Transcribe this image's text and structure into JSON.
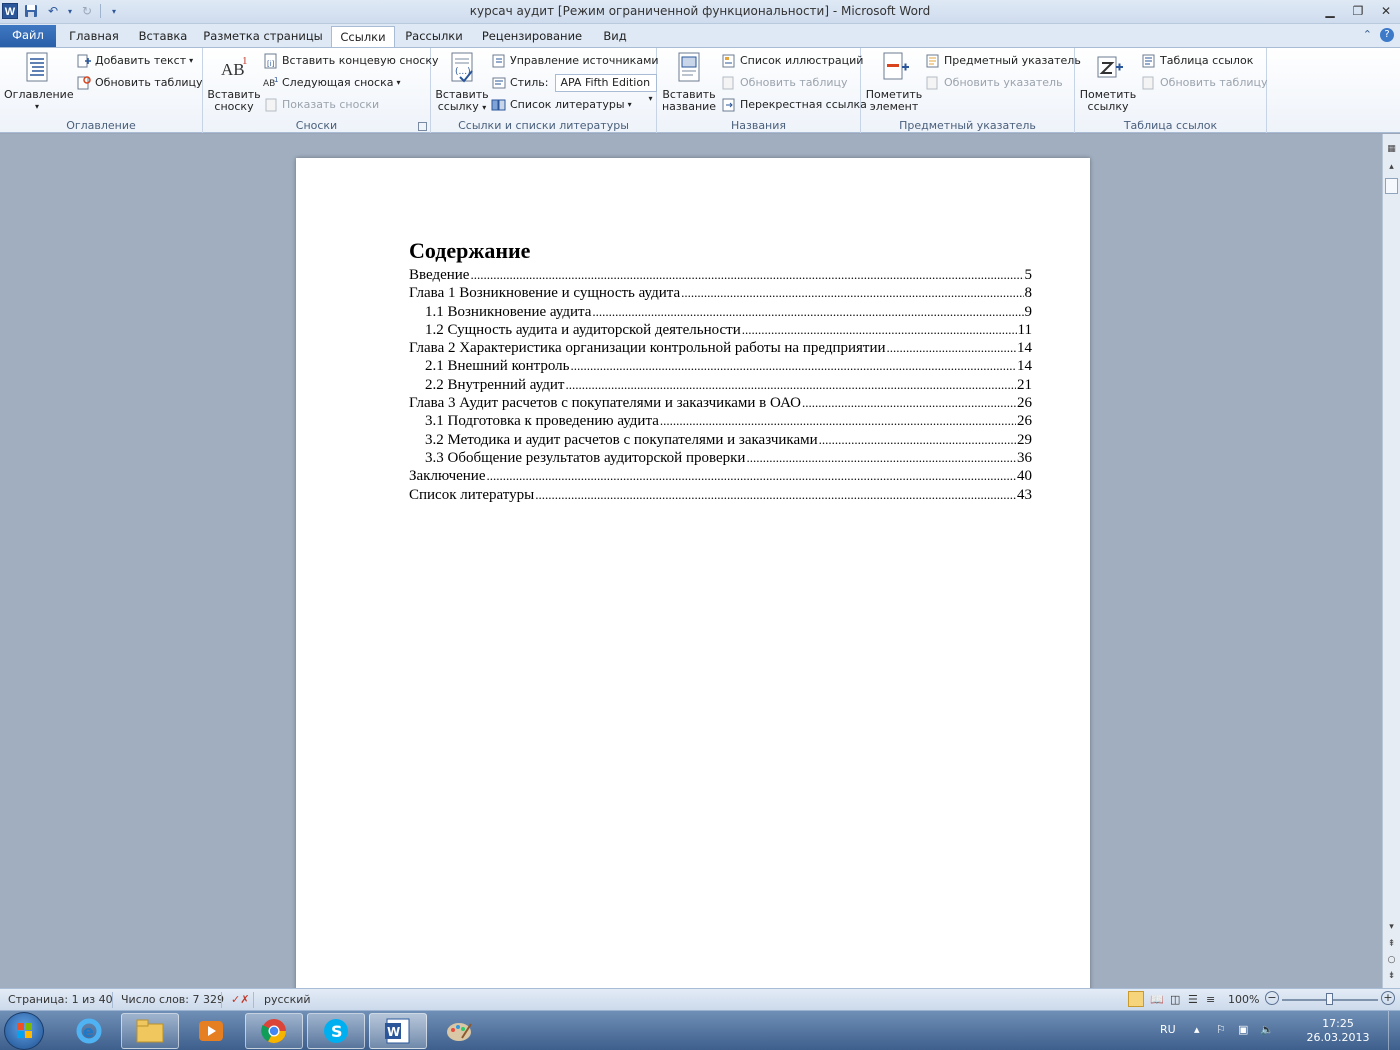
{
  "app": {
    "title": "курсач аудит [Режим ограниченной функциональности]  -  Microsoft Word",
    "logo": "W"
  },
  "tabs": {
    "file": "Файл",
    "items": [
      "Главная",
      "Вставка",
      "Разметка страницы",
      "Ссылки",
      "Рассылки",
      "Рецензирование",
      "Вид"
    ],
    "active": "Ссылки"
  },
  "ribbon": {
    "toc": {
      "label": "Оглавление",
      "big": "Оглавление",
      "add_text": "Добавить текст",
      "update_table": "Обновить таблицу"
    },
    "footnotes": {
      "label": "Сноски",
      "insert_line1": "Вставить",
      "insert_line2": "сноску",
      "insert_endnote": "Вставить концевую сноску",
      "next_footnote": "Следующая сноска",
      "show_notes": "Показать сноски"
    },
    "citations": {
      "label": "Ссылки и списки литературы",
      "insert_line1": "Вставить",
      "insert_line2": "ссылку",
      "manage_sources": "Управление источниками",
      "style_label": "Стиль:",
      "style_value": "APA Fifth Edition",
      "bibliography": "Список литературы"
    },
    "captions": {
      "label": "Названия",
      "insert_line1": "Вставить",
      "insert_line2": "название",
      "table_of_figures": "Список иллюстраций",
      "update_table": "Обновить таблицу",
      "cross_reference": "Перекрестная ссылка"
    },
    "index": {
      "label": "Предметный указатель",
      "mark_line1": "Пометить",
      "mark_line2": "элемент",
      "insert_index": "Предметный указатель",
      "update_index": "Обновить указатель"
    },
    "authorities": {
      "label": "Таблица ссылок",
      "mark_line1": "Пометить",
      "mark_line2": "ссылку",
      "insert_table": "Таблица ссылок",
      "update_table": "Обновить таблицу"
    }
  },
  "document": {
    "toc_title": "Содержание",
    "entries": [
      {
        "text": "Введение",
        "page": "5",
        "level": 1
      },
      {
        "text": "Глава 1 Возникновение и сущность аудита",
        "page": "8",
        "level": 1
      },
      {
        "text": "1.1 Возникновение аудита",
        "page": "9",
        "level": 2
      },
      {
        "text": "1.2 Сущность аудита и аудиторской деятельности",
        "page": "11",
        "level": 2
      },
      {
        "text": "Глава 2 Характеристика организации контрольной работы на предприятии",
        "page": "14",
        "level": 1
      },
      {
        "text": "2.1 Внешний контроль",
        "page": "14",
        "level": 2
      },
      {
        "text": "2.2 Внутренний аудит",
        "page": "21",
        "level": 2
      },
      {
        "text": "Глава 3 Аудит расчетов с покупателями и заказчиками в ОАО",
        "page": "26",
        "level": 1
      },
      {
        "text": "3.1 Подготовка к проведению аудита",
        "page": "26",
        "level": 2
      },
      {
        "text": "3.2 Методика и аудит расчетов с покупателями и заказчиками",
        "page": "29",
        "level": 2
      },
      {
        "text": "3.3 Обобщение результатов аудиторской проверки",
        "page": "36",
        "level": 2
      },
      {
        "text": "Заключение",
        "page": "40",
        "level": 1
      },
      {
        "text": "Список литературы",
        "page": "43",
        "level": 1
      }
    ]
  },
  "status": {
    "page": "Страница: 1 из 40",
    "words": "Число слов: 7 329",
    "language": "русский",
    "zoom": "100%",
    "zoom_percent": 100
  },
  "tray": {
    "lang": "RU",
    "time": "17:25",
    "date": "26.03.2013"
  },
  "colors": {
    "accent": "#2b579a",
    "file_tab": "#2a5fa8",
    "taskbar": "#3e5f8c"
  }
}
